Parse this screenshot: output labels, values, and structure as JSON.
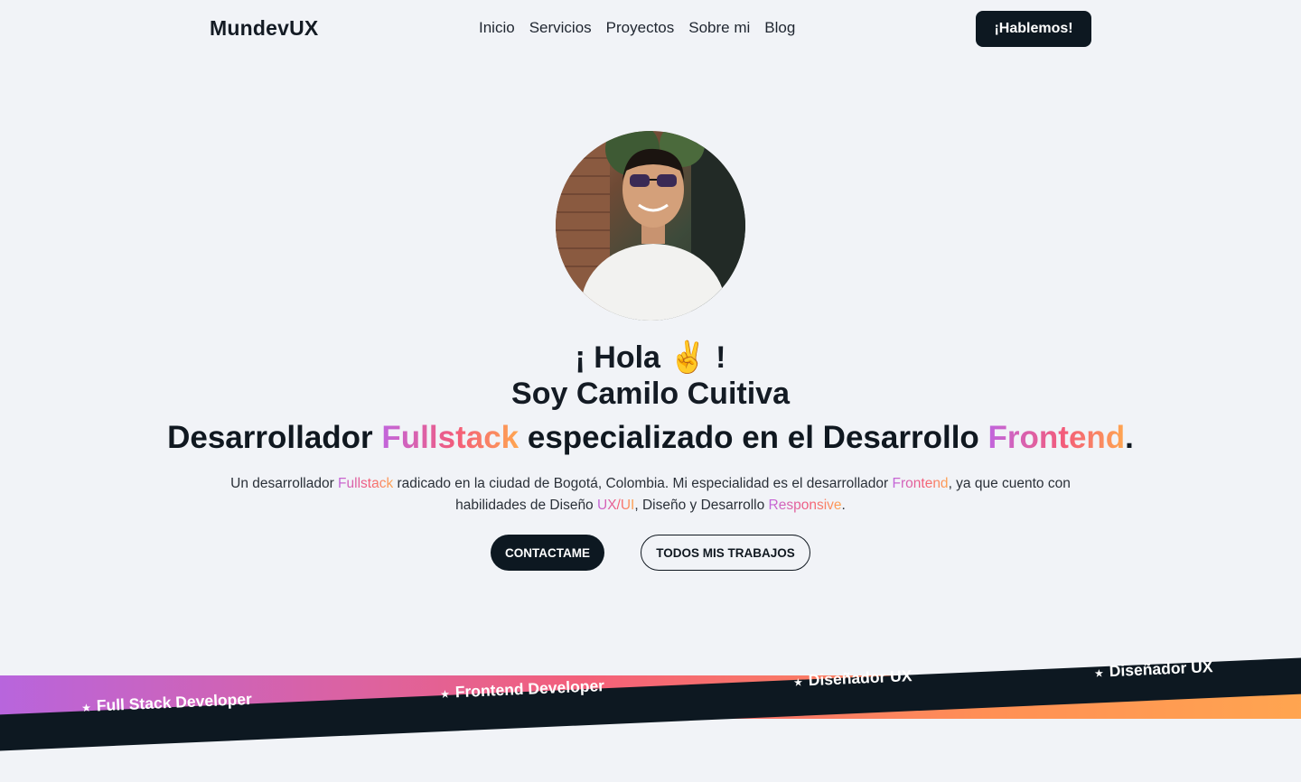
{
  "header": {
    "logo": "MundevUX",
    "nav": [
      "Inicio",
      "Servicios",
      "Proyectos",
      "Sobre mi",
      "Blog"
    ],
    "cta": "¡Hablemos!"
  },
  "hero": {
    "hello": "¡ Hola ✌️ !",
    "name": "Soy Camilo Cuitiva",
    "role_parts": [
      "Desarrollador ",
      "Fullstack",
      " especializado en el Desarrollo ",
      "Frontend",
      "."
    ],
    "description_parts": [
      "Un desarrollador ",
      "Fullstack",
      " radicado en la ciudad de Bogotá, Colombia. Mi especialidad es el desarrollador ",
      "Frontend",
      ", ya que cuento con habilidades de Diseño ",
      "UX/UI",
      ", Diseño y Desarrollo ",
      "Responsive",
      "."
    ],
    "btn_primary": "CONTACTAME",
    "btn_secondary": "TODOS MIS TRABAJOS"
  },
  "ribbon": {
    "tags": [
      "Full Stack Developer",
      "Frontend Developer",
      "Diseñador UX",
      "Diseñador UX"
    ],
    "star_icon": "star-icon"
  },
  "colors": {
    "dark": "#0d1821",
    "gradient_start": "#c165dd",
    "gradient_mid": "#f35c7a",
    "gradient_end": "#ffa650",
    "background": "#f1f3f7"
  }
}
